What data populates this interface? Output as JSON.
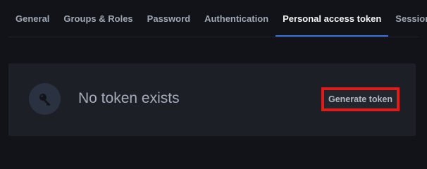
{
  "tabs": [
    {
      "label": "General",
      "active": false
    },
    {
      "label": "Groups & Roles",
      "active": false
    },
    {
      "label": "Password",
      "active": false
    },
    {
      "label": "Authentication",
      "active": false
    },
    {
      "label": "Personal access token",
      "active": true
    },
    {
      "label": "Session",
      "active": false
    }
  ],
  "token_panel": {
    "icon": "key-icon",
    "message": "No token exists",
    "generate_label": "Generate token"
  },
  "colors": {
    "background": "#111318",
    "card": "#1c1f26",
    "active_tab_underline": "#3d71d9",
    "highlight_border": "#e01b1b"
  }
}
